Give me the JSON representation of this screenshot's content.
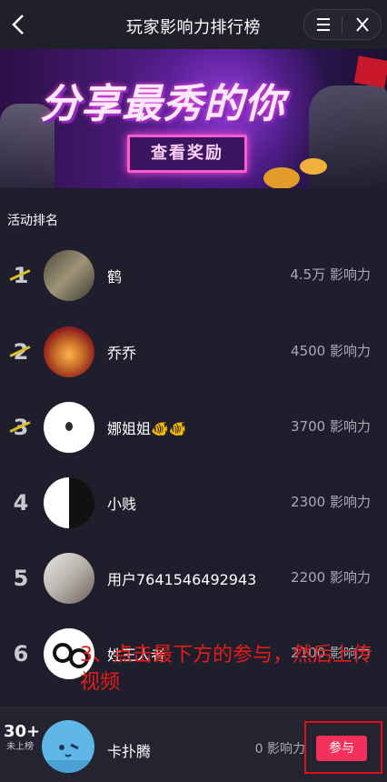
{
  "header": {
    "title": "玩家影响力排行榜"
  },
  "banner": {
    "headline": "分享最秀的你",
    "cta_label": "查看奖励"
  },
  "section_title": "活动排名",
  "rankings": [
    {
      "rank": "1",
      "name": "鹤",
      "score": "4.5万 影响力"
    },
    {
      "rank": "2",
      "name": "乔乔",
      "score": "4500 影响力"
    },
    {
      "rank": "3",
      "name": "娜姐姐🐠🐠",
      "score": "3700 影响力"
    },
    {
      "rank": "4",
      "name": "小贱",
      "score": "2300 影响力"
    },
    {
      "rank": "5",
      "name": "用户7641546492943",
      "score": "2200 影响力"
    },
    {
      "rank": "6",
      "name": "姓王人者",
      "score": "2100 影响力"
    }
  ],
  "annotation": "3、点击最下方的参与，然后上传视频",
  "my_entry": {
    "rank": "30+",
    "rank_note": "未上榜",
    "name": "卡扑腾",
    "score": "0 影响力",
    "join_label": "参与"
  },
  "colors": {
    "background": "#1f1e2c",
    "accent": "#f5305a",
    "annotation": "#e81b1b"
  }
}
